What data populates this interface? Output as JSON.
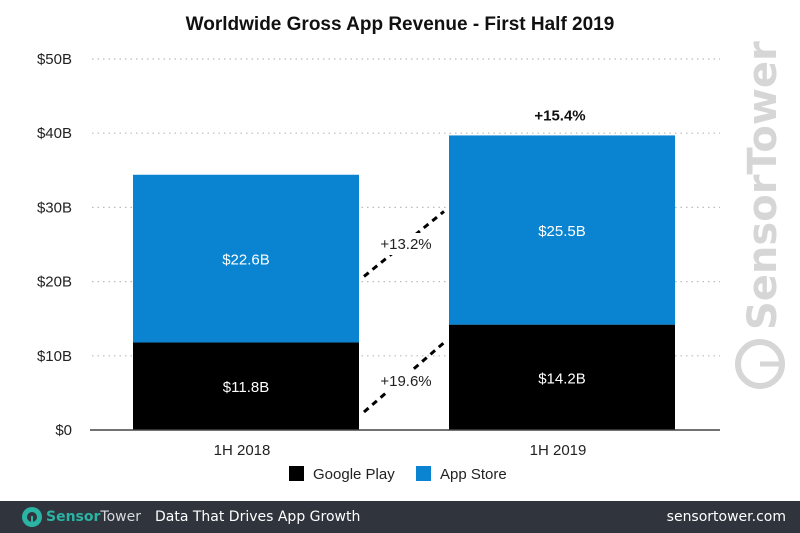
{
  "chart_data": {
    "type": "bar",
    "stacked": true,
    "title": "Worldwide Gross App Revenue - First Half 2019",
    "xlabel": "",
    "ylabel": "",
    "categories": [
      "1H 2018",
      "1H 2019"
    ],
    "series": [
      {
        "name": "Google Play",
        "color": "#000000",
        "values": [
          11.8,
          14.2
        ],
        "labels": [
          "$11.8B",
          "$14.2B"
        ]
      },
      {
        "name": "App Store",
        "color": "#0a84d0",
        "values": [
          22.6,
          25.5
        ],
        "labels": [
          "$22.6B",
          "$25.5B"
        ]
      }
    ],
    "ylim": [
      0,
      50
    ],
    "yticks": [
      0,
      10,
      20,
      30,
      40,
      50
    ],
    "ytick_labels": [
      "$0",
      "$10B",
      "$20B",
      "$30B",
      "$40B",
      "$50B"
    ],
    "grid": true,
    "annotations": {
      "google_play_growth": "+19.6%",
      "app_store_growth": "+13.2%",
      "total_growth": "+15.4%"
    },
    "legend": {
      "placement": "bottom-center",
      "entries": [
        "Google Play",
        "App Store"
      ]
    },
    "watermark": "SensorTower"
  },
  "footer": {
    "brand_part1": "Sensor",
    "brand_part2": "Tower",
    "tagline": "Data That Drives App Growth",
    "site": "sensortower.com"
  }
}
